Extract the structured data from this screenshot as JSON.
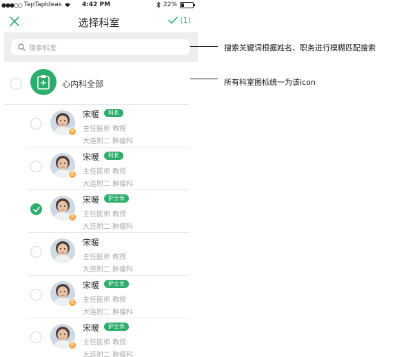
{
  "status_bar": {
    "carrier": "TapTapIdeas",
    "time": "4:42 PM",
    "battery": "22%",
    "battery_level": 0.22
  },
  "nav": {
    "title": "选择科室",
    "confirm_count": "(1)"
  },
  "search": {
    "placeholder": "搜索科室"
  },
  "department": {
    "label": "心内科全部"
  },
  "members": [
    {
      "name": "宋暖",
      "tag": "科长",
      "title": "主任医师  教授",
      "dept": "大连附二 肿瘤科",
      "checked": false,
      "badge": "医"
    },
    {
      "name": "宋暖",
      "tag": "科长",
      "title": "主任医师  教授",
      "dept": "大连附二 肿瘤科",
      "checked": false,
      "badge": "医"
    },
    {
      "name": "宋暖",
      "tag": "护士长",
      "title": "主任医师  教授",
      "dept": "大连附二 肿瘤科",
      "checked": true,
      "badge": "医"
    },
    {
      "name": "宋暖",
      "tag": "",
      "title": "主任医师  教授",
      "dept": "大连附二 肿瘤科",
      "checked": false,
      "badge": ""
    },
    {
      "name": "宋暖",
      "tag": "护士长",
      "title": "主任医师  教授",
      "dept": "大连附二 肿瘤科",
      "checked": false,
      "badge": "医"
    },
    {
      "name": "宋暖",
      "tag": "护士长",
      "title": "主任医师  教授",
      "dept": "大连附二 肿瘤科",
      "checked": false,
      "badge": "医"
    }
  ],
  "annotations": {
    "search_note": "搜索关键词根据姓名、职务进行模糊匹配搜索",
    "icon_note": "所有科室图标统一为该icon"
  },
  "colors": {
    "accent": "#2dad6c",
    "badge": "#f3a33c"
  }
}
